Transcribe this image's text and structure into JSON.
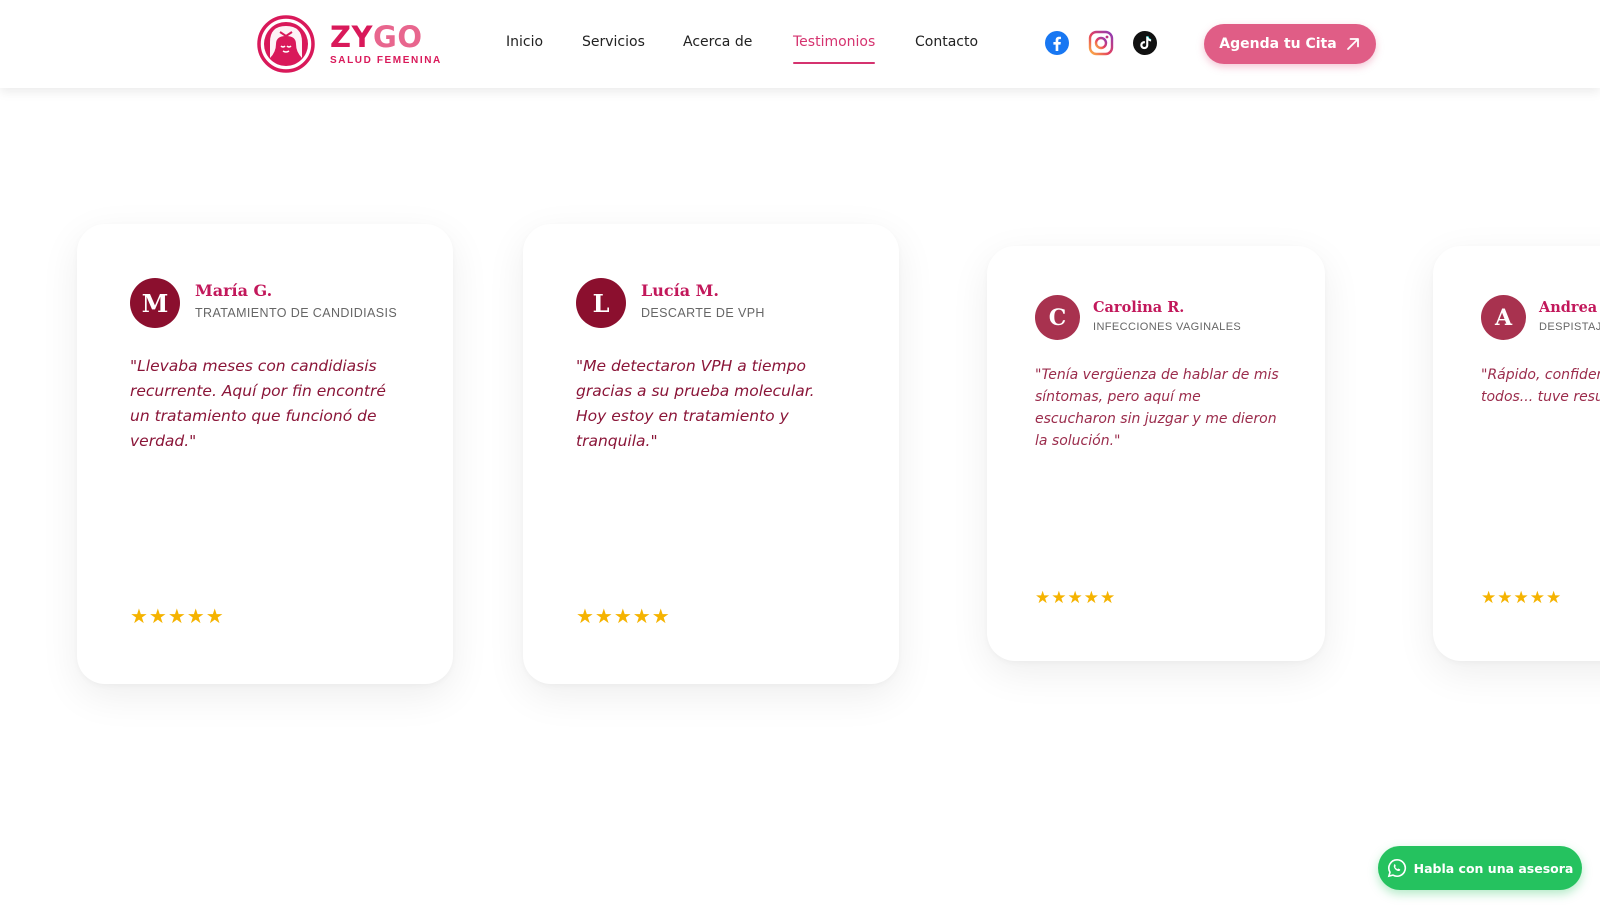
{
  "brand": {
    "name_part1": "ZY",
    "name_part2": "GO",
    "tagline": "SALUD FEMENINA",
    "primary_color": "#d9195a",
    "accent_color": "#e05d86"
  },
  "nav": {
    "items": [
      {
        "label": "Inicio",
        "active": false
      },
      {
        "label": "Servicios",
        "active": false
      },
      {
        "label": "Acerca de",
        "active": false
      },
      {
        "label": "Testimonios",
        "active": true
      },
      {
        "label": "Contacto",
        "active": false
      }
    ]
  },
  "social": [
    "facebook-icon",
    "instagram-icon",
    "tiktok-icon"
  ],
  "cta": {
    "label": "Agenda tu Cita",
    "icon": "arrow-up-right-icon"
  },
  "testimonials": [
    {
      "initial": "M",
      "name": "María G.",
      "treatment": "TRATAMIENTO DE CANDIDIASIS",
      "quote": "\"Llevaba meses con candidiasis recurrente. Aquí por fin encontré un tratamiento que funcionó de verdad.\"",
      "rating": 5,
      "stars": "★★★★★",
      "avatar_color": "#8b0f2e"
    },
    {
      "initial": "L",
      "name": "Lucía M.",
      "treatment": "DESCARTE DE VPH",
      "quote": "\"Me detectaron VPH a tiempo gracias a su prueba molecular. Hoy estoy en tratamiento y tranquila.\"",
      "rating": 5,
      "stars": "★★★★★",
      "avatar_color": "#8b0f2e"
    },
    {
      "initial": "C",
      "name": "Carolina R.",
      "treatment": "INFECCIONES VAGINALES",
      "quote": "\"Tenía vergüenza de hablar de mis síntomas, pero aquí me escucharon sin juzgar y me dieron la solución.\"",
      "rating": 5,
      "stars": "★★★★★",
      "avatar_color": "#a8324f"
    },
    {
      "initial": "A",
      "name": "Andrea P.",
      "treatment": "DESPISTAJE",
      "quote": "\"Rápido, confidencial. Me hicieron todos... tuve resultados e...",
      "rating": 5,
      "stars": "★★★★★",
      "avatar_color": "#a8324f"
    }
  ],
  "whatsapp": {
    "label": "Habla con una asesora",
    "icon": "whatsapp-icon",
    "color": "#25c25f"
  }
}
